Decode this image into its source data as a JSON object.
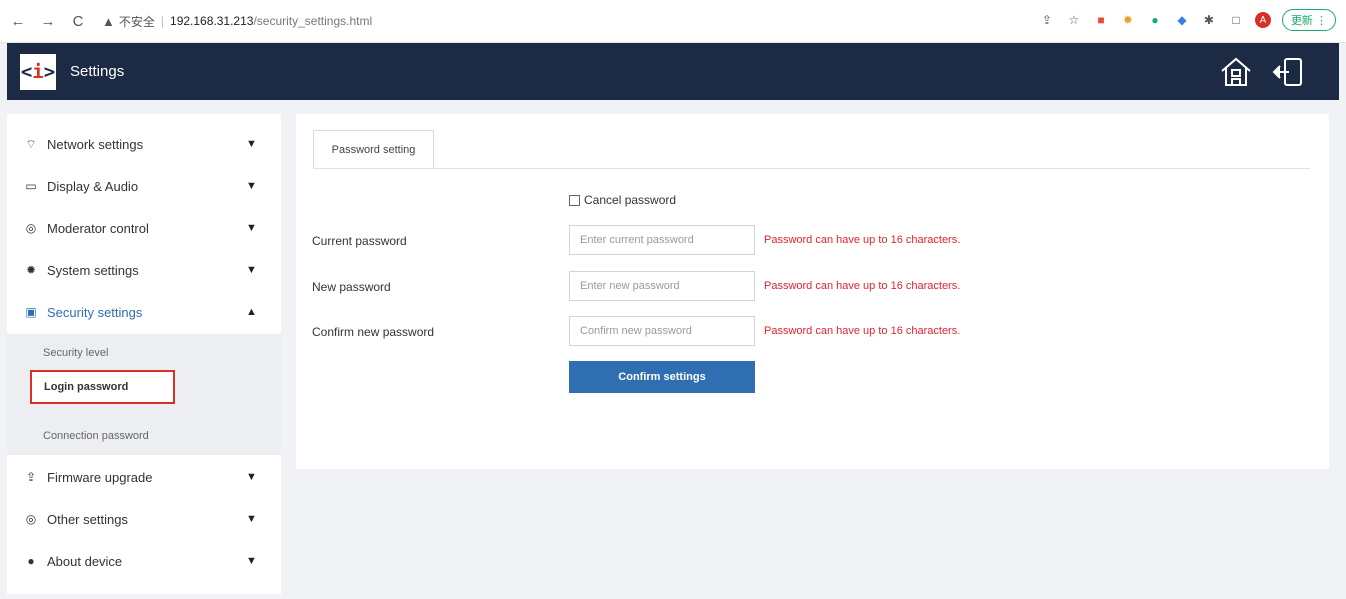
{
  "browser": {
    "back": "←",
    "forward": "→",
    "reload": "C",
    "warning": "▲",
    "insecure": "不安全",
    "url_host": "192.168.31.213",
    "url_path": "/security_settings.html",
    "avatar_letter": "A",
    "update_label": "更新 ⋮"
  },
  "header": {
    "logo_left": "<",
    "logo_mid": "i",
    "logo_right": ">",
    "title": "Settings"
  },
  "sidebar": {
    "items": [
      {
        "label": "Network settings",
        "icon": "wifi-icon",
        "expanded": false
      },
      {
        "label": "Display & Audio",
        "icon": "monitor-icon",
        "expanded": false
      },
      {
        "label": "Moderator control",
        "icon": "moderator-icon",
        "expanded": false
      },
      {
        "label": "System settings",
        "icon": "gear-icon",
        "expanded": false
      },
      {
        "label": "Security settings",
        "icon": "lock-icon",
        "expanded": true
      },
      {
        "label": "Firmware upgrade",
        "icon": "upload-icon",
        "expanded": false
      },
      {
        "label": "Other settings",
        "icon": "other-icon",
        "expanded": false
      },
      {
        "label": "About device",
        "icon": "info-icon",
        "expanded": false
      }
    ],
    "sub_items": [
      "Security level",
      "Login password",
      "Connection password"
    ],
    "chevron_down": "⌄",
    "chevron_up": "⌃"
  },
  "main": {
    "tab_label": "Password setting",
    "cancel_password_label": "Cancel password",
    "fields": [
      {
        "label": "Current password",
        "placeholder": "Enter current password",
        "hint": "Password can have up to 16 characters."
      },
      {
        "label": "New password",
        "placeholder": "Enter new password",
        "hint": "Password can have up to 16 characters."
      },
      {
        "label": "Confirm new password",
        "placeholder": "Confirm new password",
        "hint": "Password can have up to 16 characters."
      }
    ],
    "confirm_button": "Confirm settings"
  },
  "colors": {
    "header_bg": "#1d2a44",
    "accent": "#2f6fb1",
    "error": "#e0242f",
    "highlight_border": "#d93025"
  }
}
